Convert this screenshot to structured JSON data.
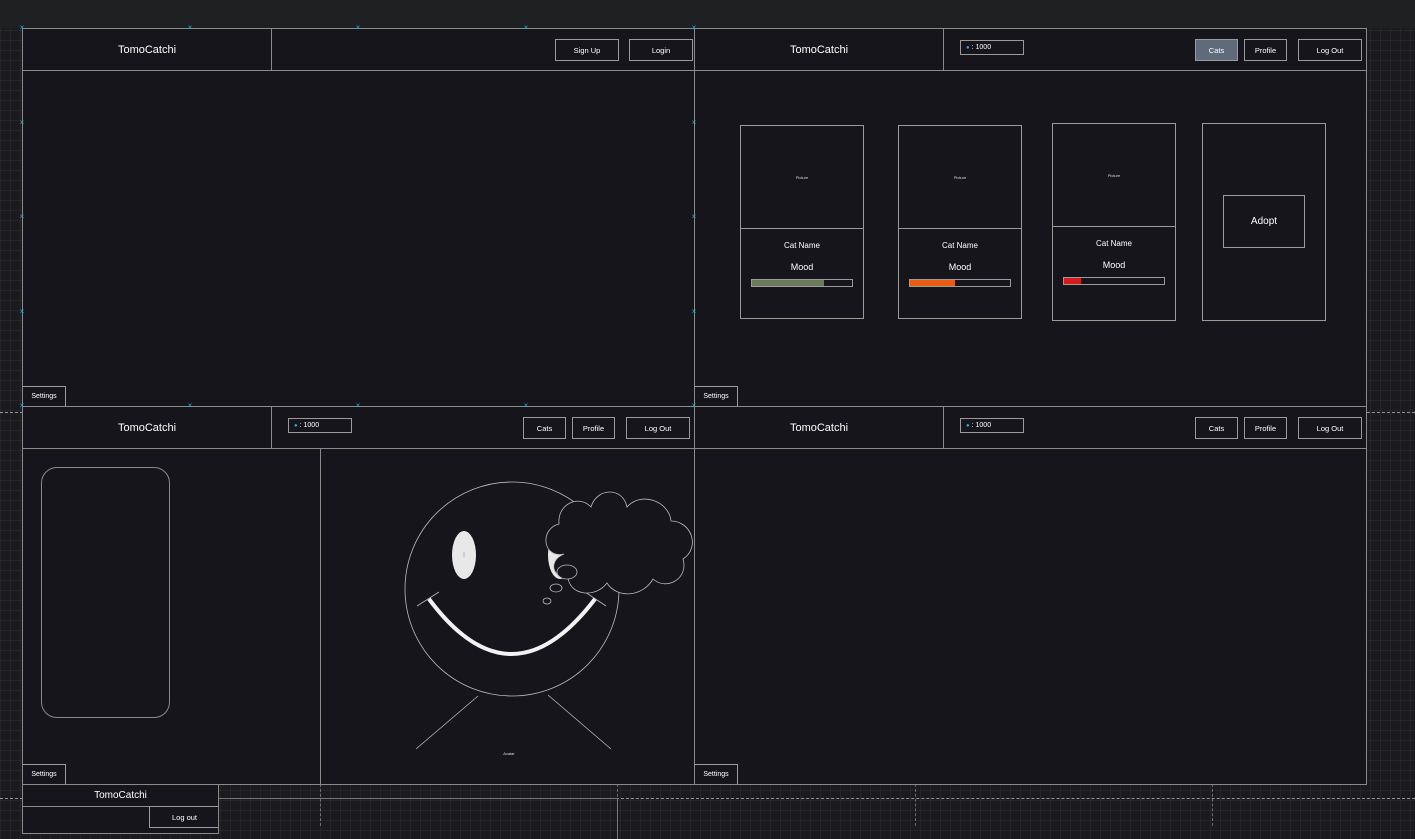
{
  "app": {
    "name": "TomoCatchi"
  },
  "auth": {
    "signup_label": "Sign Up",
    "login_label": "Login"
  },
  "nav": {
    "cats_label": "Cats",
    "profile_label": "Profile",
    "logout_label": "Log Out"
  },
  "currency": {
    "icon": "coin-icon",
    "amount": ": 1000"
  },
  "settings_label": "Settings",
  "cats": [
    {
      "picture_label": "Picture",
      "name": "Cat Name",
      "mood_label": "Mood",
      "mood_level": 0.72,
      "mood_color": "#6a7a5a"
    },
    {
      "picture_label": "Picture",
      "name": "Cat Name",
      "mood_label": "Mood",
      "mood_level": 0.45,
      "mood_color": "#e85d10"
    },
    {
      "picture_label": "Picture",
      "name": "Cat Name",
      "mood_label": "Mood",
      "mood_level": 0.17,
      "mood_color": "#d7191c"
    }
  ],
  "adopt_label": "Adopt",
  "avatar_label": "Avatar",
  "mobile": {
    "logout_label": "Log out"
  },
  "colors": {
    "background": "#16151c",
    "accent_active": "#5f6b7a",
    "handle": "#2fa8d8"
  }
}
